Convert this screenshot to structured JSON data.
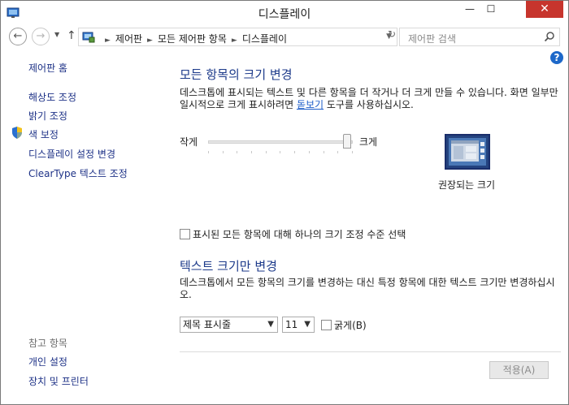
{
  "window": {
    "title": "디스플레이",
    "minimize_glyph": "—",
    "maximize_glyph": "☐",
    "close_glyph": "✕"
  },
  "addressbar": {
    "breadcrumbs": [
      "제어판",
      "모든 제어판 항목",
      "디스플레이"
    ],
    "search_placeholder": "제어판 검색"
  },
  "leftnav": {
    "home": "제어판 홈",
    "items": [
      "해상도 조정",
      "밝기 조정",
      "색 보정",
      "디스플레이 설정 변경",
      "ClearType 텍스트 조정"
    ],
    "see_also_heading": "참고 항목",
    "see_also": [
      "개인 설정",
      "장치 및 프린터"
    ]
  },
  "main": {
    "size_section": {
      "heading": "모든 항목의 크기 변경",
      "desc_prefix": "데스크톱에 표시되는 텍스트 및 다른 항목을 더 작거나 더 크게 만들 수 있습니다. 화면 일부만 일시적으로 크게 표시하려면 ",
      "desc_link": "돋보기",
      "desc_suffix": " 도구를 사용하십시오.",
      "label_small": "작게",
      "label_large": "크게",
      "slider_value": 1.0,
      "preview_caption": "권장되는 크기",
      "single_scale_label": "표시된 모든 항목에 대해 하나의 크기 조정 수준 선택",
      "single_scale_checked": false
    },
    "text_section": {
      "heading": "텍스트 크기만 변경",
      "desc": "데스크톱에서 모든 항목의 크기를 변경하는 대신 특정 항목에 대한 텍스트 크기만 변경하십시오.",
      "item_select": "제목 표시줄",
      "size_select": "11",
      "bold_label": "굵게(B)",
      "bold_checked": false
    },
    "apply_button": "적용(A)"
  },
  "colors": {
    "link": "#1e3287",
    "heading": "#1c3a8a",
    "close_button": "#c7352d",
    "help": "#1d68c9"
  }
}
